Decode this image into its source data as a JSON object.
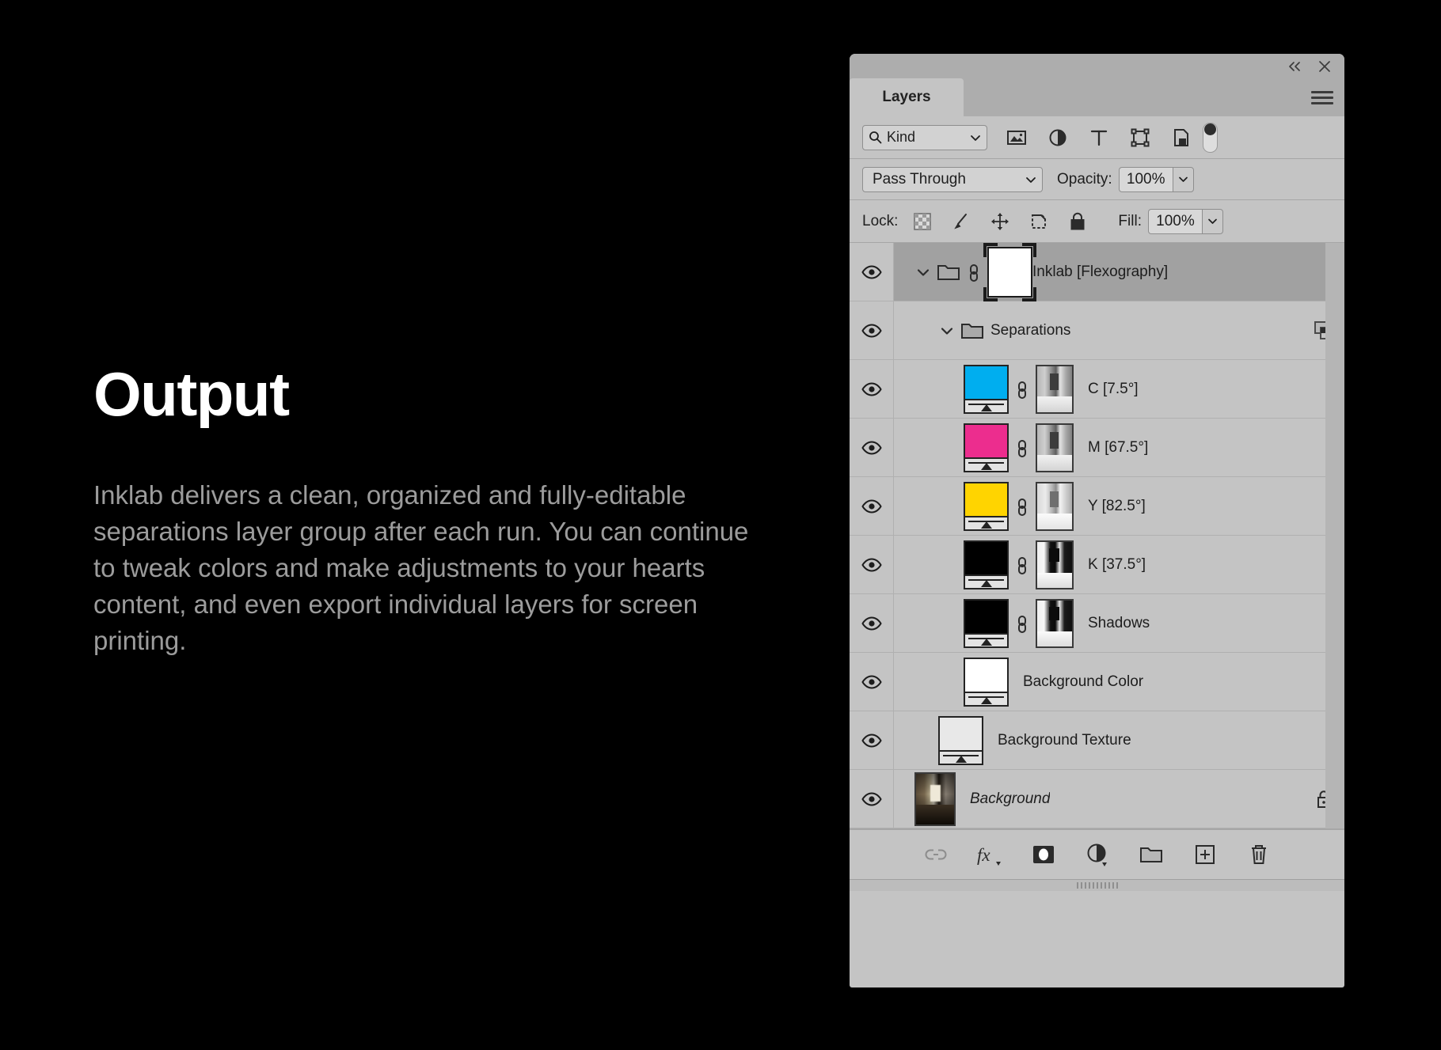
{
  "slide": {
    "title": "Output",
    "body": "Inklab delivers a clean, organized and fully-editable separations layer group after each run. You can continue to tweak colors and make adjustments to your hearts content, and even export individual layers for screen printing.",
    "background_color": "#000000",
    "title_color": "#ffffff",
    "body_color": "#9c9c9c"
  },
  "panel": {
    "titlebar": {
      "collapse_label": "«",
      "close_label": "×"
    },
    "tab": {
      "label": "Layers"
    },
    "menu_icon": "hamburger-menu-icon",
    "filter": {
      "kind_label": "Kind",
      "search_icon": "search-icon",
      "caret_icon": "chevron-down-icon",
      "icons": [
        {
          "name": "filter-pixel-layers-icon",
          "title": "Pixel layers"
        },
        {
          "name": "filter-adjustment-layers-icon",
          "title": "Adjustment layers"
        },
        {
          "name": "filter-type-layers-icon",
          "title": "Type layers"
        },
        {
          "name": "filter-shape-layers-icon",
          "title": "Shape layers"
        },
        {
          "name": "filter-smart-object-layers-icon",
          "title": "Smart object layers"
        }
      ],
      "toggle_name": "filter-enable-toggle"
    },
    "blend": {
      "mode": "Pass Through",
      "opacity_label": "Opacity:",
      "opacity_value": "100%"
    },
    "lock": {
      "label": "Lock:",
      "icons": [
        {
          "name": "lock-transparent-pixels-icon"
        },
        {
          "name": "lock-image-pixels-icon"
        },
        {
          "name": "lock-position-icon"
        },
        {
          "name": "lock-artboard-nesting-icon"
        },
        {
          "name": "lock-all-icon"
        }
      ],
      "fill_label": "Fill:",
      "fill_value": "100%"
    },
    "layers": [
      {
        "name": "Inklab [Flexography]",
        "type": "group",
        "indent": 0,
        "selected": true,
        "visible": true,
        "expanded": true,
        "has_link": true,
        "thumb": "white-mask-selected",
        "swatch": "#ffffff",
        "italic": false,
        "right_icon": null
      },
      {
        "name": "Separations",
        "type": "group",
        "indent": 1,
        "selected": false,
        "visible": true,
        "expanded": true,
        "has_link": false,
        "thumb": "none",
        "swatch": null,
        "italic": false,
        "right_icon": "clipping-group-icon"
      },
      {
        "name": "C [7.5°]",
        "type": "solid-color",
        "indent": 2,
        "selected": false,
        "visible": true,
        "expanded": false,
        "has_link": true,
        "thumb": "solid+mask",
        "swatch": "#00AEEF",
        "italic": false,
        "right_icon": null
      },
      {
        "name": "M [67.5°]",
        "type": "solid-color",
        "indent": 2,
        "selected": false,
        "visible": true,
        "expanded": false,
        "has_link": true,
        "thumb": "solid+mask",
        "swatch": "#EC2D8E",
        "italic": false,
        "right_icon": null
      },
      {
        "name": "Y [82.5°]",
        "type": "solid-color",
        "indent": 2,
        "selected": false,
        "visible": true,
        "expanded": false,
        "has_link": true,
        "thumb": "solid+mask",
        "swatch": "#FFD400",
        "italic": false,
        "right_icon": null
      },
      {
        "name": "K [37.5°]",
        "type": "solid-color",
        "indent": 2,
        "selected": false,
        "visible": true,
        "expanded": false,
        "has_link": true,
        "thumb": "solid+mask",
        "swatch": "#000000",
        "italic": false,
        "right_icon": null
      },
      {
        "name": "Shadows",
        "type": "solid-color",
        "indent": 2,
        "selected": false,
        "visible": true,
        "expanded": false,
        "has_link": true,
        "thumb": "solid+mask",
        "swatch": "#000000",
        "italic": false,
        "right_icon": null
      },
      {
        "name": "Background Color",
        "type": "solid-color",
        "indent": 2,
        "selected": false,
        "visible": true,
        "expanded": false,
        "has_link": false,
        "thumb": "solid",
        "swatch": "#ffffff",
        "italic": false,
        "right_icon": null
      },
      {
        "name": "Background Texture",
        "type": "solid-color",
        "indent": 1,
        "selected": false,
        "visible": true,
        "expanded": false,
        "has_link": false,
        "thumb": "solid",
        "swatch": "#e8e8e8",
        "italic": false,
        "right_icon": null
      },
      {
        "name": "Background",
        "type": "image",
        "indent": 0,
        "selected": false,
        "visible": true,
        "expanded": false,
        "has_link": false,
        "thumb": "photo",
        "swatch": null,
        "italic": true,
        "right_icon": "lock-icon"
      }
    ],
    "bottom_bar": [
      {
        "name": "link-layers-button",
        "glyph": "link-icon",
        "dim": true
      },
      {
        "name": "add-layer-style-button",
        "glyph": "fx-icon",
        "dim": false
      },
      {
        "name": "add-layer-mask-button",
        "glyph": "layer-mask-icon",
        "dim": false
      },
      {
        "name": "new-adjustment-layer-button",
        "glyph": "half-circle-icon",
        "dim": false
      },
      {
        "name": "new-group-button",
        "glyph": "folder-icon",
        "dim": false
      },
      {
        "name": "new-layer-button",
        "glyph": "plus-square-icon",
        "dim": false
      },
      {
        "name": "delete-layer-button",
        "glyph": "trash-icon",
        "dim": false
      }
    ]
  }
}
